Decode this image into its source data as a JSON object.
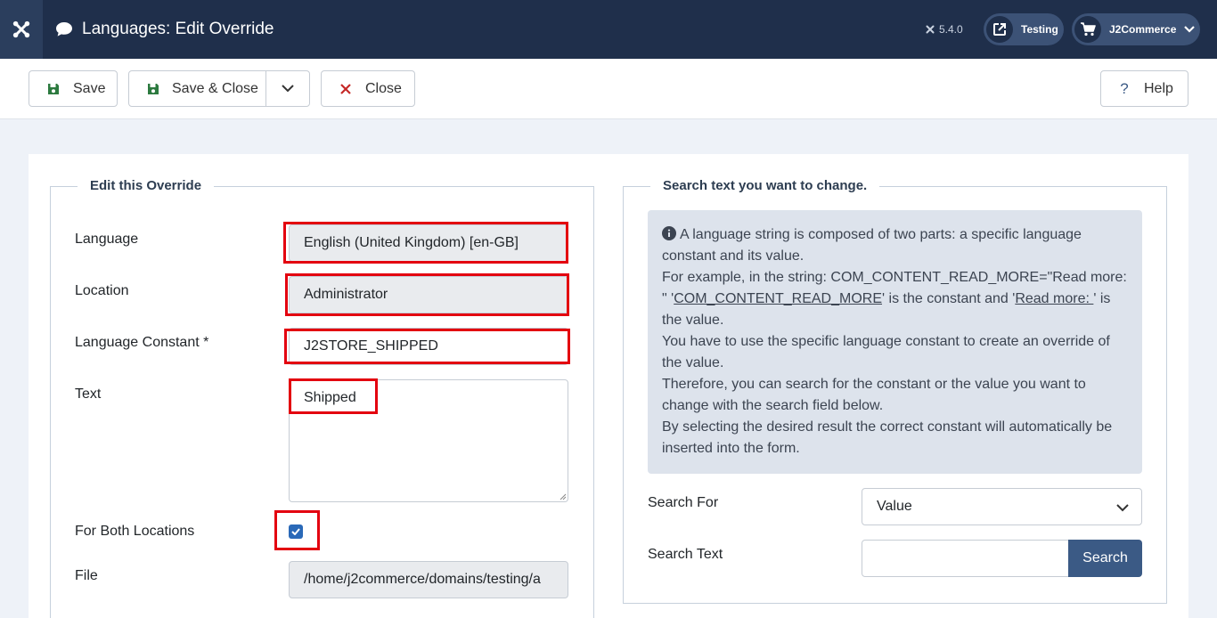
{
  "header": {
    "title": "Languages: Edit Override",
    "version": "5.4.0",
    "site_label": "Testing",
    "user_label": "J2Commerce"
  },
  "toolbar": {
    "save_label": "Save",
    "save_close_label": "Save & Close",
    "close_label": "Close",
    "help_label": "Help"
  },
  "edit_override": {
    "legend": "Edit this Override",
    "language_label": "Language",
    "language_value": "English (United Kingdom) [en-GB]",
    "location_label": "Location",
    "location_value": "Administrator",
    "constant_label": "Language Constant *",
    "constant_value": "J2STORE_SHIPPED",
    "text_label": "Text",
    "text_value": "Shipped",
    "both_locations_label": "For Both Locations",
    "both_locations_checked": true,
    "file_label": "File",
    "file_value": "/home/j2commerce/domains/testing/a"
  },
  "search_panel": {
    "legend": "Search text you want to change.",
    "info": {
      "line1": "A language string is composed of two parts: a specific language constant and its value.",
      "line2_prefix": "For example, in the string: COM_CONTENT_READ_MORE=\"Read more: \"",
      "quote_open": "'",
      "constant_example": "COM_CONTENT_READ_MORE",
      "mid_text": "' is the constant and '",
      "value_example": "Read more: ",
      "end_text": "' is the value.",
      "line3": "You have to use the specific language constant to create an override of the value.",
      "line4": "Therefore, you can search for the constant or the value you want to change with the search field below.",
      "line5": "By selecting the desired result the correct constant will automatically be inserted into the form."
    },
    "search_for_label": "Search For",
    "search_for_value": "Value",
    "search_text_label": "Search Text",
    "search_text_value": "",
    "search_button": "Search"
  }
}
